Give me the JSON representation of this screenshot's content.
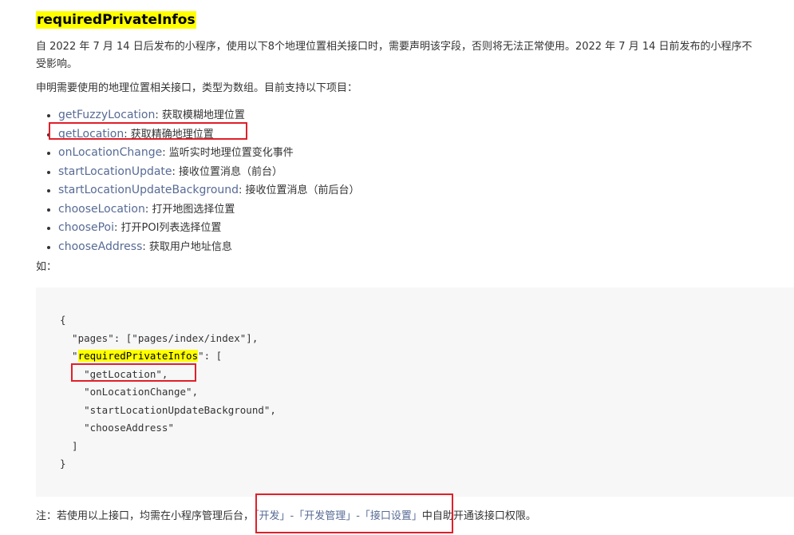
{
  "heading": "requiredPrivateInfos",
  "intro_line1": "自 2022 年 7 月 14 日后发布的小程序，使用以下8个地理位置相关接口时，需要声明该字段，否则将无法正常使用。2022 年 7 月 14 日前发布的小程序不",
  "intro_line2": "受影响。",
  "desc": "申明需要使用的地理位置相关接口，类型为数组。目前支持以下项目：",
  "apis": [
    {
      "name": "getFuzzyLocation",
      "desc": ": 获取模糊地理位置"
    },
    {
      "name": "getLocation",
      "desc": ": 获取精确地理位置"
    },
    {
      "name": "onLocationChange",
      "desc": ": 监听实时地理位置变化事件"
    },
    {
      "name": "startLocationUpdate",
      "desc": ": 接收位置消息（前台）"
    },
    {
      "name": "startLocationUpdateBackground",
      "desc": ": 接收位置消息（前后台）"
    },
    {
      "name": "chooseLocation",
      "desc": ": 打开地图选择位置"
    },
    {
      "name": "choosePoi",
      "desc": ": 打开POI列表选择位置"
    },
    {
      "name": "chooseAddress",
      "desc": ": 获取用户地址信息"
    }
  ],
  "example_label": "如：",
  "code": {
    "l1": "{",
    "l2": "  \"pages\": [\"pages/index/index\"],",
    "l3_pre": "  \"",
    "l3_key": "requiredPrivateInfos",
    "l3_post": "\": [",
    "l4": "    \"getLocation\",",
    "l5": "    \"onLocationChange\",",
    "l6": "    \"startLocationUpdateBackground\",",
    "l7": "    \"chooseAddress\"",
    "l8": "  ]",
    "l9": "}"
  },
  "note": {
    "prefix": "注：若使用以上接口，均需在小程序管理后台，",
    "link": "「开发」-「开发管理」-「接口设置」",
    "suffix": "中自助开通该接口权限。"
  },
  "colors": {
    "highlight": "#ffff00",
    "link": "#576b95",
    "annotation": "#e0202a",
    "code_bg": "#f7f7f7"
  }
}
